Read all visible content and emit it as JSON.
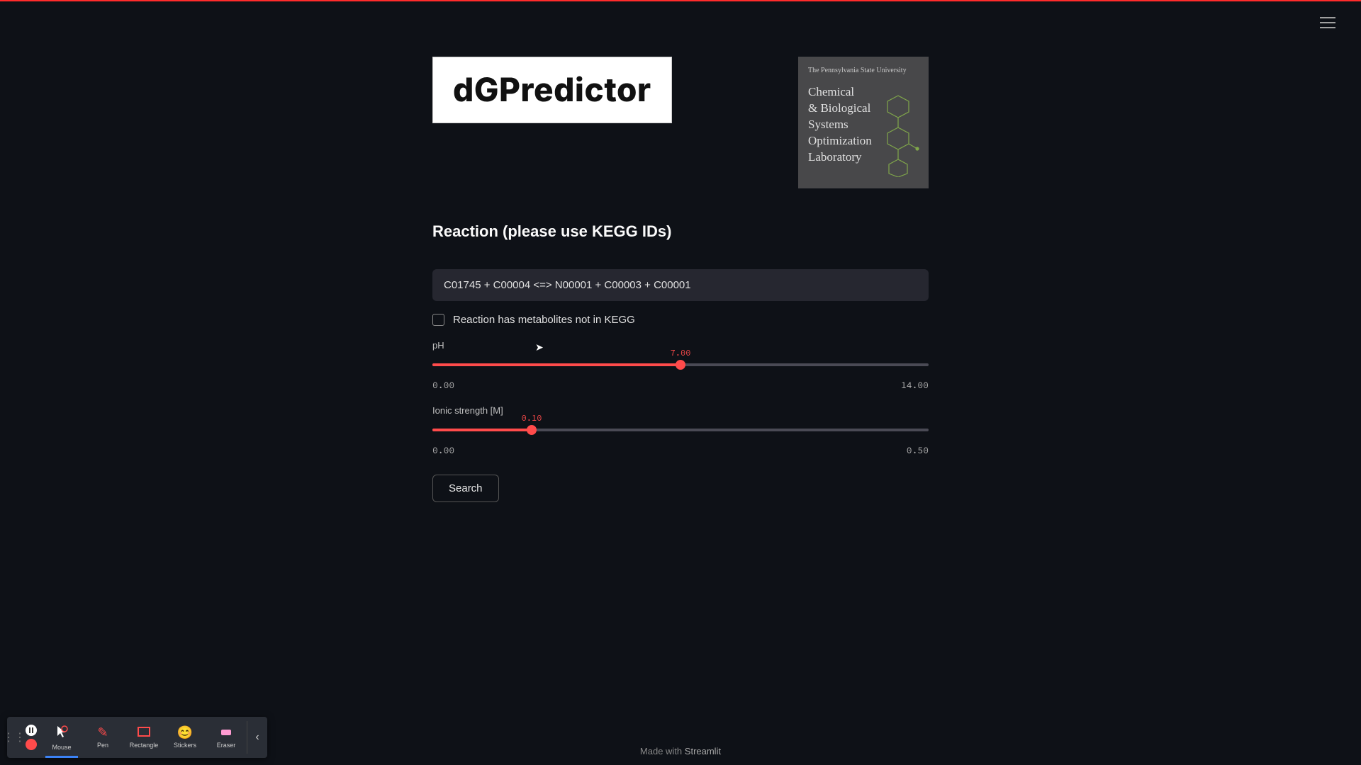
{
  "app": {
    "logo_text": "dGPredictor",
    "lab_university": "The Pennsylvania State University",
    "lab_department": "Chemical\n& Biological\nSystems\nOptimization\nLaboratory"
  },
  "form": {
    "heading": "Reaction (please use KEGG IDs)",
    "reaction_value": "C01745 + C00004 <=> N00001 + C00003 + C00001",
    "checkbox_label": "Reaction has metabolites not in KEGG",
    "ph": {
      "label": "pH",
      "min": "0.00",
      "max": "14.00",
      "value": "7.00",
      "value_num": 7.0,
      "min_num": 0.0,
      "max_num": 14.0
    },
    "ionic": {
      "label": "Ionic strength [M]",
      "min": "0.00",
      "max": "0.50",
      "value": "0.10",
      "value_num": 0.1,
      "min_num": 0.0,
      "max_num": 0.5
    },
    "search_label": "Search"
  },
  "footer": {
    "prefix": "Made with ",
    "brand": "Streamlit"
  },
  "toolbar": {
    "mouse": "Mouse",
    "pen": "Pen",
    "rectangle": "Rectangle",
    "stickers": "Stickers",
    "eraser": "Eraser"
  }
}
